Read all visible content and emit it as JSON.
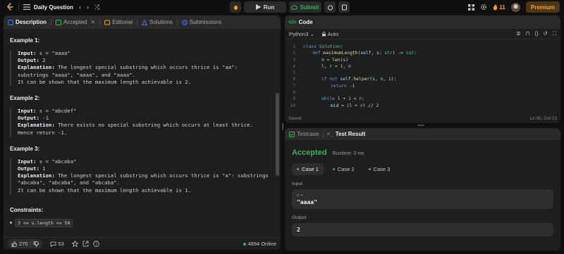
{
  "topbar": {
    "title": "Daily Question",
    "run_label": "Run",
    "submit_label": "Submit",
    "streak": "11",
    "premium_label": "Premium"
  },
  "left": {
    "tabs": [
      {
        "label": "Description"
      },
      {
        "label": "Accepted"
      },
      {
        "label": "Editorial"
      },
      {
        "label": "Solutions"
      },
      {
        "label": "Submissions"
      }
    ],
    "examples": [
      {
        "title": "Example 1:",
        "input_label": "Input:",
        "input_value": "s = \"aaaa\"",
        "output_label": "Output:",
        "output_value": "2",
        "explanation_label": "Explanation:",
        "explanation_line1": "The longest special substring which occurs thrice is \"aa\":",
        "explanation_line2": "substrings \"aaaa\", \"aaaa\", and \"aaaa\".",
        "explanation_line3": "It can be shown that the maximum length achievable is 2."
      },
      {
        "title": "Example 2:",
        "input_label": "Input:",
        "input_value": "s = \"abcdef\"",
        "output_label": "Output:",
        "output_value": "-1",
        "explanation_label": "Explanation:",
        "explanation_line1": "There exists no special substring which occurs at least thrice.",
        "explanation_line2": "Hence return -1."
      },
      {
        "title": "Example 3:",
        "input_label": "Input:",
        "input_value": "s = \"abcaba\"",
        "output_label": "Output:",
        "output_value": "1",
        "explanation_label": "Explanation:",
        "explanation_line1": "The longest special substring which occurs thrice is \"a\": substrings",
        "explanation_line2": "\"abcaba\", \"abcaba\", and \"abcaba\".",
        "explanation_line3": "It can be shown that the maximum length achievable is 1."
      }
    ],
    "constraints_title": "Constraints:",
    "constraint_1": "3 <= s.length <= 50",
    "likes": "270",
    "comments": "53",
    "online": "4894 Online"
  },
  "code": {
    "header": "Code",
    "language": "Python3",
    "mode": "Auto",
    "status_left": "Saved",
    "status_right": "Ln 30, Col 21",
    "line_numbers": [
      "1",
      "2",
      "3",
      "4",
      "5",
      "6",
      "7",
      "8",
      "9",
      "10"
    ]
  },
  "test": {
    "tab1": "Testcase",
    "tab2": "Test Result",
    "result": "Accepted",
    "runtime": "Runtime: 0 ms",
    "cases": [
      "Case 1",
      "Case 2",
      "Case 3"
    ],
    "input_label": "Input",
    "input_var": "s =",
    "input_value": "\"aaaa\"",
    "output_label": "Output",
    "output_value": "2"
  },
  "colors": {
    "accent_green": "#2db55d",
    "accent_orange": "#ffa116",
    "panel_bg": "#1e1e1e",
    "page_bg": "#0f0f0f"
  }
}
